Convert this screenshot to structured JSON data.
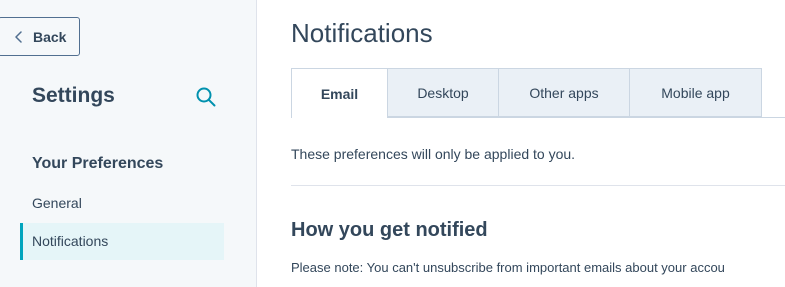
{
  "sidebar": {
    "back_label": "Back",
    "title": "Settings",
    "section_label": "Your Preferences",
    "items": [
      {
        "label": "General"
      },
      {
        "label": "Notifications"
      }
    ]
  },
  "main": {
    "title": "Notifications",
    "tabs": [
      {
        "label": "Email"
      },
      {
        "label": "Desktop"
      },
      {
        "label": "Other apps"
      },
      {
        "label": "Mobile app"
      }
    ],
    "description": "These preferences will only be applied to you.",
    "section_heading": "How you get notified",
    "note": "Please note: You can't unsubscribe from important emails about your accou"
  },
  "colors": {
    "accent": "#00a4bd",
    "text": "#33475b",
    "sidebar_bg": "#f5f8fa",
    "active_item_bg": "#e5f5f8",
    "tab_bg": "#eaf0f6"
  },
  "icons": {
    "back": "chevron-left-icon",
    "search": "search-icon"
  }
}
